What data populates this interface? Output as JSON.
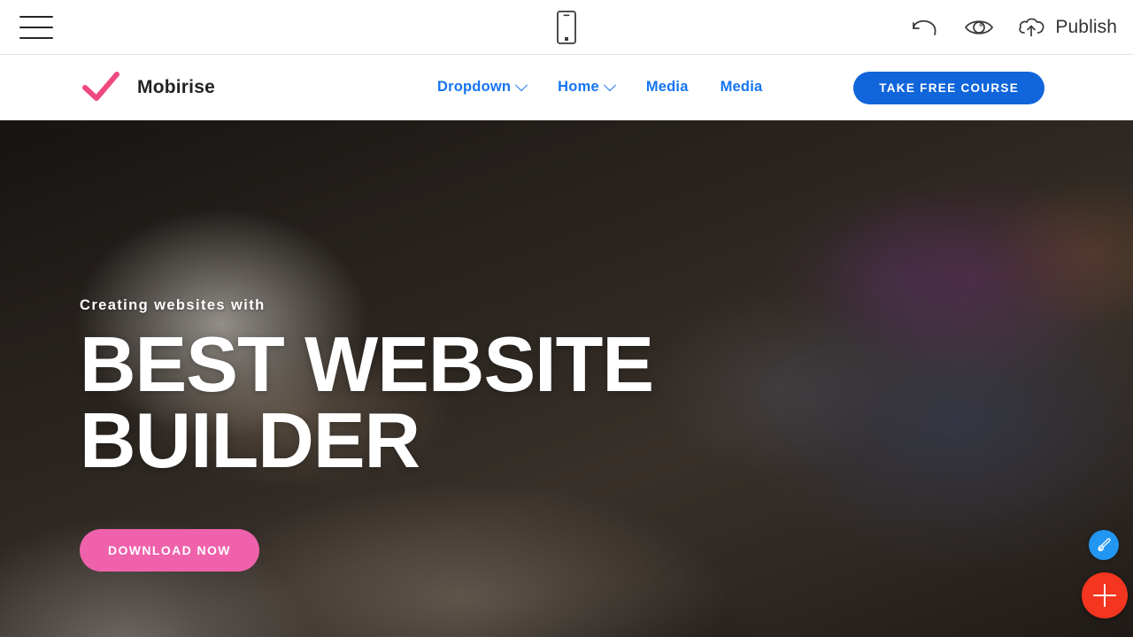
{
  "builder_toolbar": {
    "menu_icon": "hamburger-menu-icon",
    "device_icon": "mobile-device-icon",
    "undo_icon": "undo-arrow-icon",
    "preview_icon": "eye-preview-icon",
    "publish_icon": "cloud-upload-icon",
    "publish_label": "Publish"
  },
  "site_header": {
    "logo_icon": "checkmark-logo-icon",
    "brand_name": "Mobirise",
    "nav_items": [
      {
        "label": "Dropdown",
        "has_caret": true
      },
      {
        "label": "Home",
        "has_caret": true
      },
      {
        "label": "Media",
        "has_caret": false
      },
      {
        "label": "Media",
        "has_caret": false
      }
    ],
    "cta_label": "TAKE FREE COURSE"
  },
  "hero": {
    "kicker": "Creating websites with",
    "title_line1": "BEST WEBSITE",
    "title_line2": "BUILDER",
    "cta_label": "DOWNLOAD NOW"
  },
  "floating_actions": {
    "style_icon": "paint-brush-icon",
    "add_icon": "plus-icon"
  },
  "colors": {
    "logo_pink": "#ef4a7f",
    "nav_blue": "#1675f0",
    "cta_blue": "#1065db",
    "hero_cta_pink": "#ef61ab",
    "fab_blue": "#2196f3",
    "fab_red": "#f4351f",
    "toolbar_text": "#333333"
  }
}
